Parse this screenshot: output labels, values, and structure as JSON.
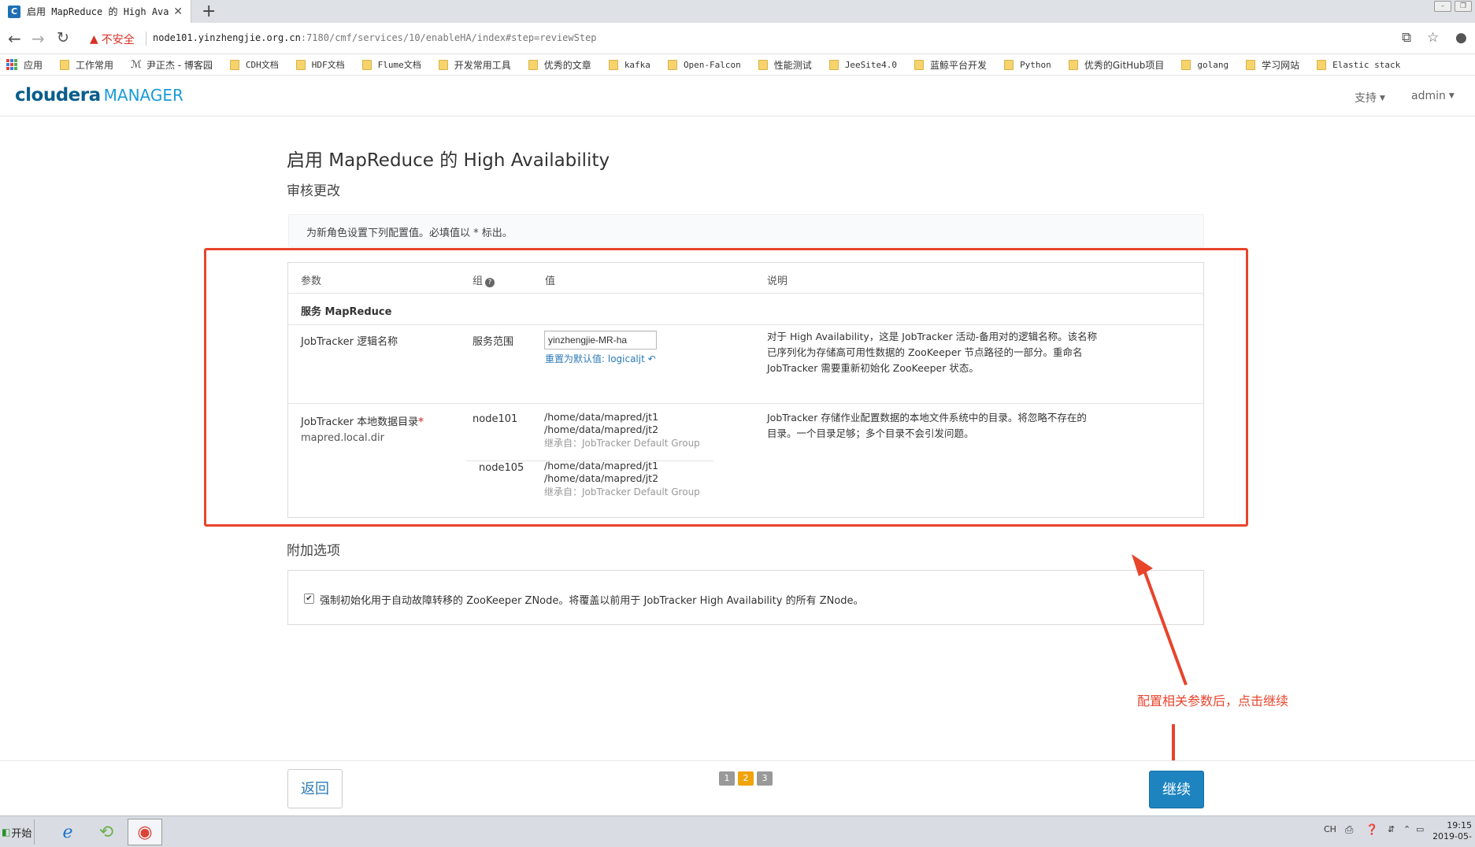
{
  "browser": {
    "tab_title": "启用 MapReduce 的 High Avail…",
    "tab_favicon": "C",
    "new_tab": "+",
    "security_label": "不安全",
    "url_host": "node101.yinzhengjie.org.cn",
    "url_path": ":7180/cmf/services/10/enableHA/index#step=reviewStep"
  },
  "bookmarks": [
    {
      "label": "应用",
      "icon": "apps-grid-icon"
    },
    {
      "label": "工作常用",
      "icon": "folder-icon"
    },
    {
      "label": "尹正杰 - 博客园",
      "icon": "blog-icon"
    },
    {
      "label": "CDH文档",
      "icon": "folder-icon"
    },
    {
      "label": "HDF文档",
      "icon": "folder-icon"
    },
    {
      "label": "Flume文档",
      "icon": "folder-icon"
    },
    {
      "label": "开发常用工具",
      "icon": "folder-icon"
    },
    {
      "label": "优秀的文章",
      "icon": "folder-icon"
    },
    {
      "label": "kafka",
      "icon": "folder-icon"
    },
    {
      "label": "Open-Falcon",
      "icon": "folder-icon"
    },
    {
      "label": "性能测试",
      "icon": "folder-icon"
    },
    {
      "label": "JeeSite4.0",
      "icon": "folder-icon"
    },
    {
      "label": "蓝鲸平台开发",
      "icon": "folder-icon"
    },
    {
      "label": "Python",
      "icon": "folder-icon"
    },
    {
      "label": "优秀的GitHub项目",
      "icon": "folder-icon"
    },
    {
      "label": "golang",
      "icon": "folder-icon"
    },
    {
      "label": "学习网站",
      "icon": "folder-icon"
    },
    {
      "label": "Elastic stack",
      "icon": "folder-icon"
    }
  ],
  "header": {
    "logo_main": "cloudera",
    "logo_sub": "MANAGER",
    "support": "支持",
    "user": "admin"
  },
  "main": {
    "title": "启用 MapReduce 的 High Availability",
    "section": "审核更改",
    "info": "为新角色设置下列配置值。必填值以 * 标出。",
    "table": {
      "headers": {
        "param": "参数",
        "group": "组",
        "value": "值",
        "desc": "说明"
      },
      "group_label": "服务 MapReduce",
      "row1": {
        "param": "JobTracker 逻辑名称",
        "group": "服务范围",
        "input_value": "yinzhengjie-MR-ha",
        "reset": "重置为默认值: logicaljt",
        "desc_lines": [
          "对于 High Availability，这是 JobTracker 活动-备用对的逻辑名称。该名称",
          "已序列化为存储高可用性数据的 ZooKeeper 节点路径的一部分。重命名",
          "JobTracker 需要重新初始化 ZooKeeper 状态。"
        ]
      },
      "row2": {
        "param": "JobTracker 本地数据目录",
        "required_mark": "*",
        "param_key": "mapred.local.dir",
        "desc_lines": [
          "JobTracker 存储作业配置数据的本地文件系统中的目录。将忽略不存在的",
          "目录。一个目录足够；多个目录不会引发问题。"
        ],
        "hosts": [
          {
            "name": "node101",
            "paths": [
              "/home/data/mapred/jt1",
              "/home/data/mapred/jt2"
            ],
            "inherit": "继承自：JobTracker Default Group"
          },
          {
            "name": "node105",
            "paths": [
              "/home/data/mapred/jt1",
              "/home/data/mapred/jt2"
            ],
            "inherit": "继承自：JobTracker Default Group"
          }
        ]
      }
    },
    "extra": {
      "title": "附加选项",
      "checkbox_checked": true,
      "checkbox_label": "强制初始化用于自动故障转移的 ZooKeeper ZNode。将覆盖以前用于 JobTracker High Availability 的所有 ZNode。"
    }
  },
  "annotation": {
    "text": "配置相关参数后，点击继续",
    "color": "#e8442c"
  },
  "footer": {
    "back": "返回",
    "pages": [
      "1",
      "2",
      "3"
    ],
    "current_page": "2",
    "continue": "继续"
  },
  "taskbar": {
    "start": "开始",
    "lang": "CH",
    "time": "19:15",
    "date": "2019-05-"
  },
  "colors": {
    "accent": "#1d84c0",
    "highlight": "#e8442c",
    "pager_active": "#f0a30a"
  }
}
